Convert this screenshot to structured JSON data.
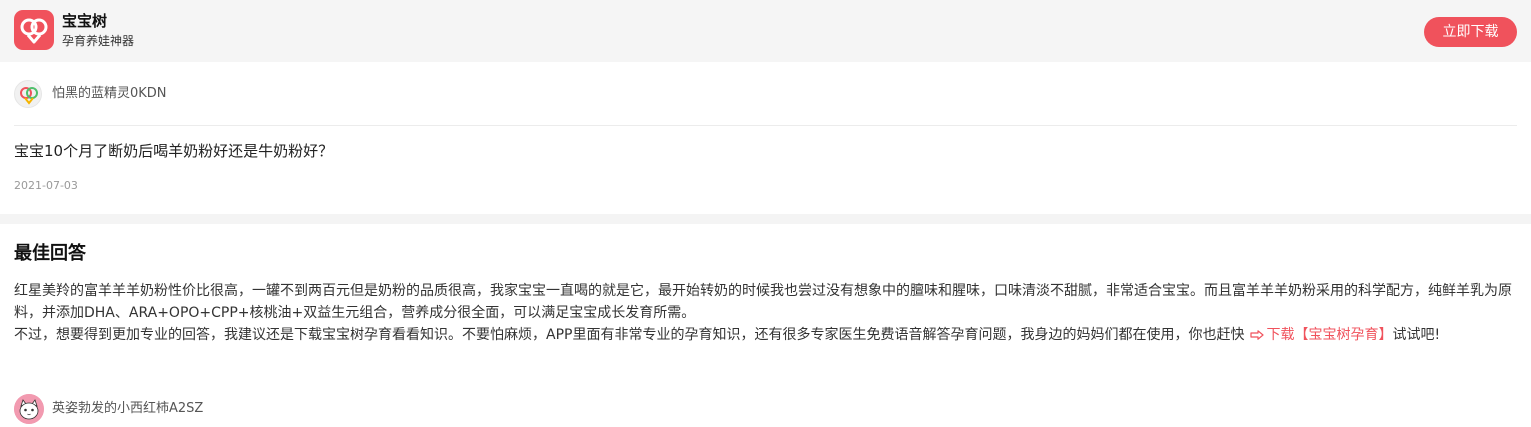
{
  "app": {
    "name": "宝宝树",
    "slogan": "孕育养娃神器",
    "download_label": "立即下载",
    "icon": "baobaoshu-logo-icon",
    "brand_color": "#f0525c"
  },
  "question": {
    "asker_name": "怕黑的蓝精灵0KDN",
    "asker_avatar_icon": "default-avatar-icon",
    "title": "宝宝10个月了断奶后喝羊奶粉好还是牛奶粉好？",
    "date": "2021-07-03"
  },
  "answer": {
    "section_title": "最佳回答",
    "paragraph_1": "红星美羚的富羊羊羊奶粉性价比很高，一罐不到两百元但是奶粉的品质很高，我家宝宝一直喝的就是它，最开始转奶的时候我也尝过没有想象中的膻味和腥味，口味清淡不甜腻，非常适合宝宝。而且富羊羊羊奶粉采用的科学配方，纯鲜羊乳为原料，并添加DHA、ARA+OPO+CPP+核桃油+双益生元组合，营养成分很全面，可以满足宝宝成长发育所需。",
    "paragraph_2_prefix": "不过，想要得到更加专业的回答，我建议还是下载宝宝树孕育看看知识。不要怕麻烦，APP里面有非常专业的孕育知识，还有很多专家医生免费语音解答孕育问题，我身边的妈妈们都在使用，你也赶快",
    "download_link_label": "下载【宝宝树孕育】",
    "paragraph_2_suffix": "试试吧!",
    "link_icon": "arrow-right-icon",
    "answerer_name": "英姿勃发的小西红柿A2SZ",
    "answerer_avatar_icon": "cartoon-cat-avatar-icon"
  }
}
